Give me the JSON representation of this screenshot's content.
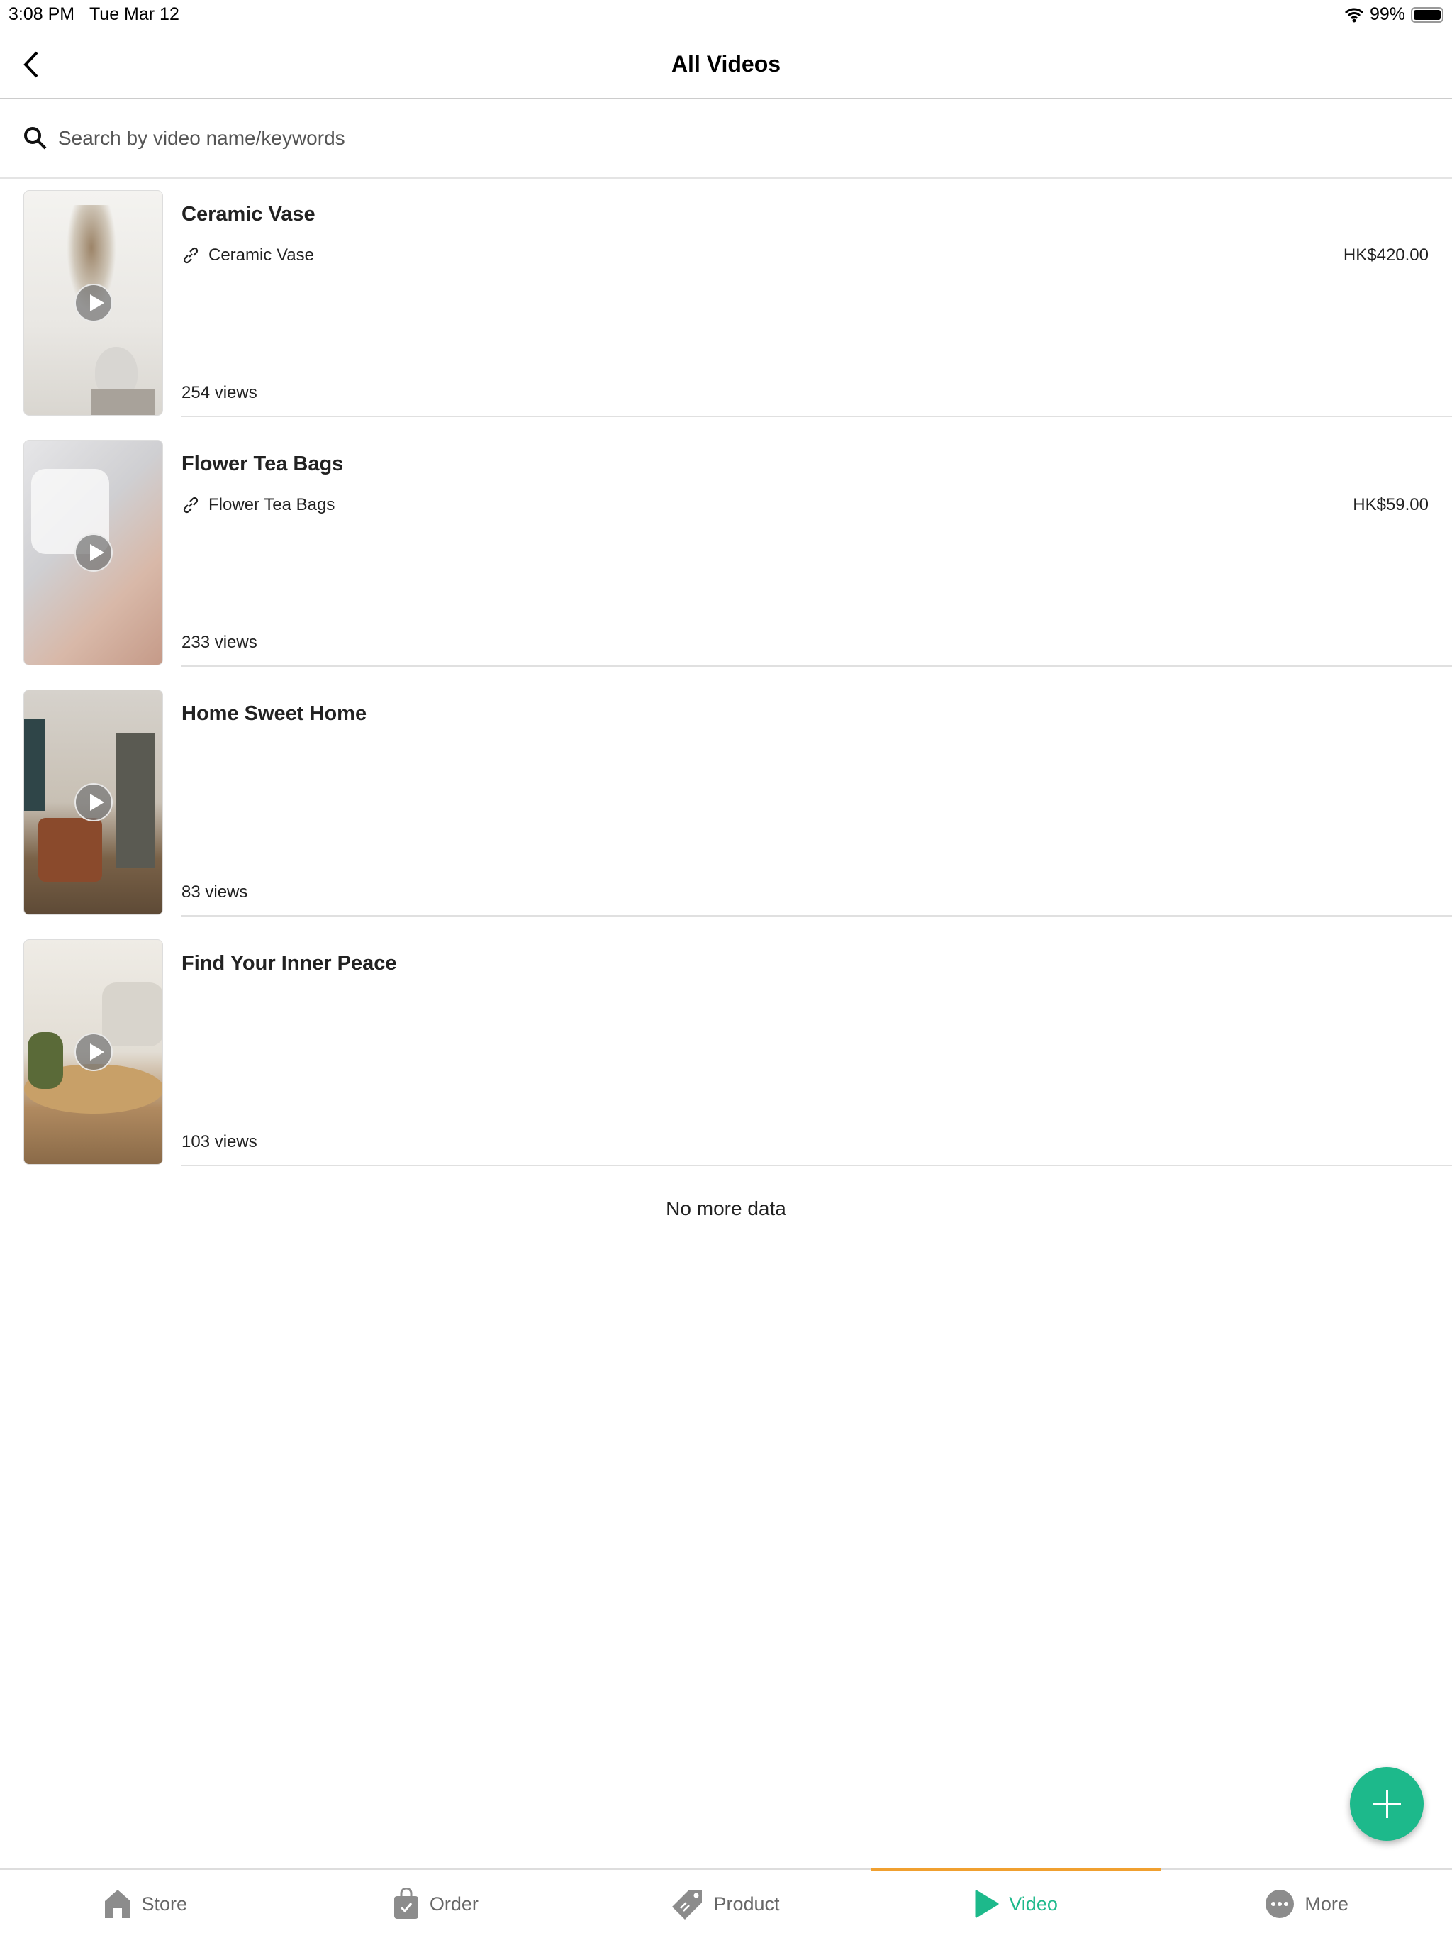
{
  "status": {
    "time": "3:08 PM",
    "date": "Tue Mar 12",
    "battery": "99%",
    "battery_level": 0.99
  },
  "nav": {
    "title": "All Videos",
    "back_icon": "chevron-left-icon"
  },
  "search": {
    "placeholder": "Search by video name/keywords",
    "value": ""
  },
  "videos": [
    {
      "title": "Ceramic Vase",
      "product": "Ceramic Vase",
      "price": "HK$420.00",
      "views": "254 views"
    },
    {
      "title": "Flower Tea Bags",
      "product": "Flower Tea Bags",
      "price": "HK$59.00",
      "views": "233 views"
    },
    {
      "title": "Home Sweet Home",
      "views": "83 views"
    },
    {
      "title": "Find Your Inner Peace",
      "views": "103 views"
    }
  ],
  "footer": "No more data",
  "tabs": [
    {
      "label": "Store",
      "icon": "store-icon"
    },
    {
      "label": "Order",
      "icon": "bag-icon"
    },
    {
      "label": "Product",
      "icon": "tag-icon"
    },
    {
      "label": "Video",
      "icon": "play-icon",
      "active": true
    },
    {
      "label": "More",
      "icon": "more-icon"
    }
  ],
  "colors": {
    "accent": "#1db98b",
    "tab_indicator": "#f0a030"
  }
}
